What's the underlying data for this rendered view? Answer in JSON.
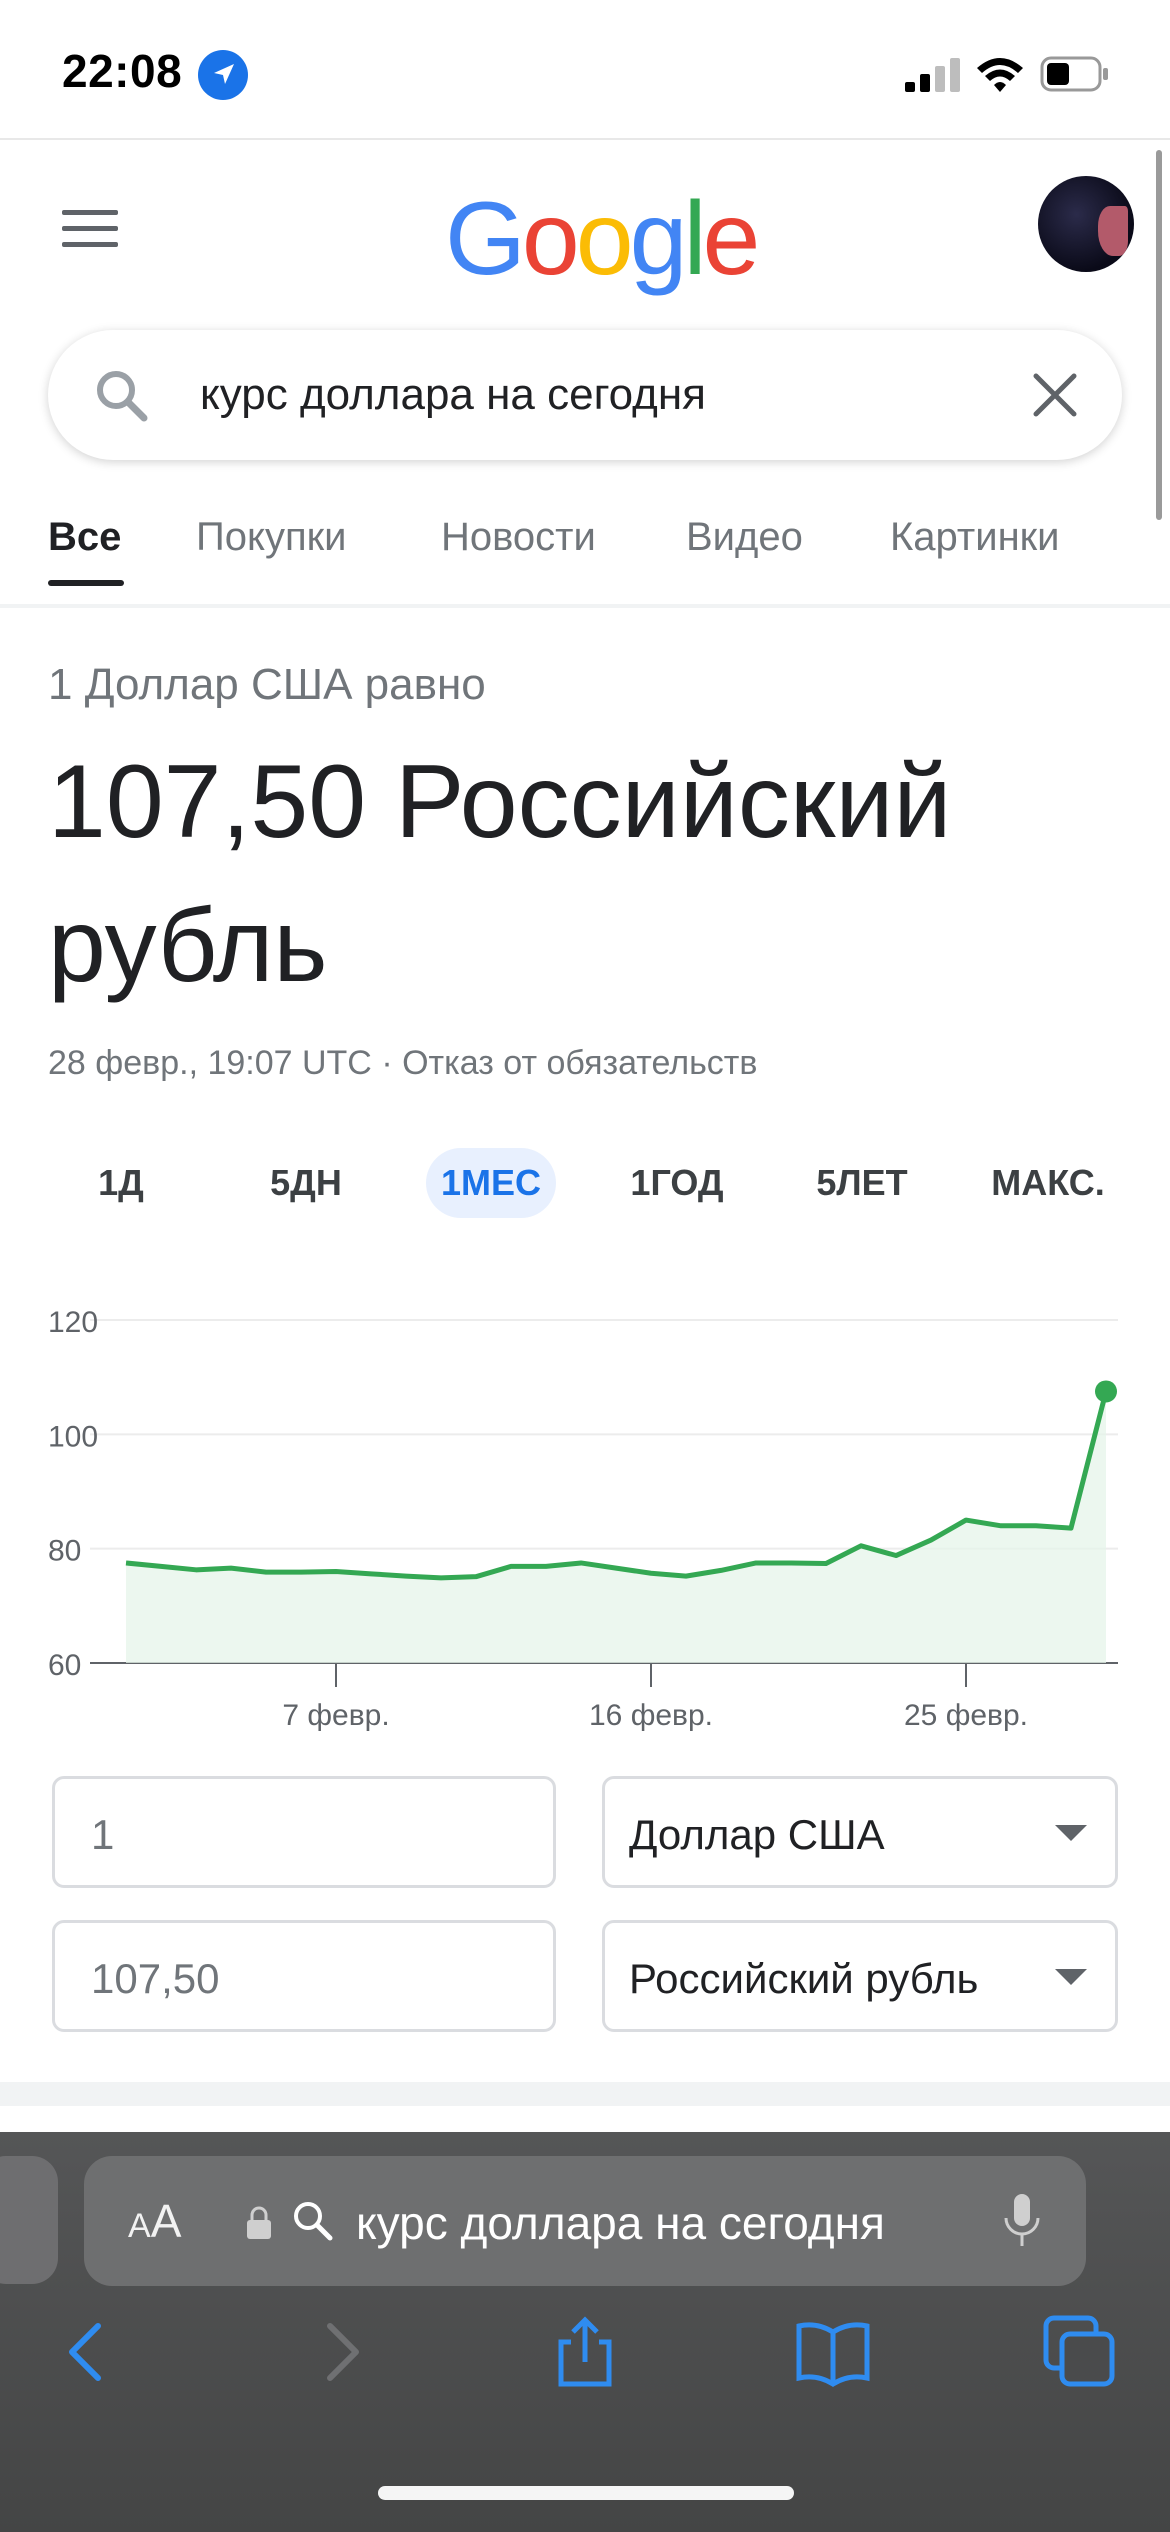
{
  "status": {
    "time": "22:08"
  },
  "header": {
    "logo": [
      "G",
      "o",
      "o",
      "g",
      "l",
      "e"
    ],
    "logo_colors": [
      "#4285F4",
      "#EA4335",
      "#FBBC05",
      "#4285F4",
      "#34A853",
      "#EA4335"
    ]
  },
  "search": {
    "query": "курс доллара на сегодня"
  },
  "tabs": [
    {
      "label": "Все",
      "active": true
    },
    {
      "label": "Покупки"
    },
    {
      "label": "Новости"
    },
    {
      "label": "Видео"
    },
    {
      "label": "Картинки"
    }
  ],
  "conversion": {
    "label": "1 Доллар США равно",
    "value": "107,50 Российский рубль",
    "date": "28 февр., 19:07 UTC",
    "separator": " · ",
    "disclaimer": "Отказ от обязательств"
  },
  "periods": [
    {
      "label": "1Д"
    },
    {
      "label": "5ДН"
    },
    {
      "label": "1МЕС",
      "active": true
    },
    {
      "label": "1ГОД"
    },
    {
      "label": "5ЛЕТ"
    },
    {
      "label": "МАКС."
    }
  ],
  "chart_data": {
    "type": "area",
    "y_ticks": [
      "120",
      "100",
      "80",
      "60"
    ],
    "x_ticks": [
      "7 февр.",
      "16 февр.",
      "25 февр."
    ],
    "ylim": [
      60,
      120
    ],
    "values": [
      77.5,
      76.9,
      76.3,
      76.6,
      75.9,
      75.9,
      76.0,
      75.6,
      75.2,
      74.9,
      75.1,
      76.9,
      76.9,
      77.5,
      76.6,
      75.7,
      75.2,
      76.2,
      77.5,
      77.5,
      77.4,
      80.5,
      78.8,
      81.5,
      85.0,
      84.0,
      84.0,
      83.6,
      107.5
    ],
    "x_tick_indices": [
      6,
      15,
      24
    ],
    "color": "#34A853"
  },
  "converter": {
    "from_amount": "1",
    "to_amount": "107,50",
    "from_currency": "Доллар США",
    "to_currency": "Российский рубль"
  },
  "safari": {
    "aa_small": "A",
    "aa_big": "A",
    "url_text": "курс доллара на сегодня"
  }
}
